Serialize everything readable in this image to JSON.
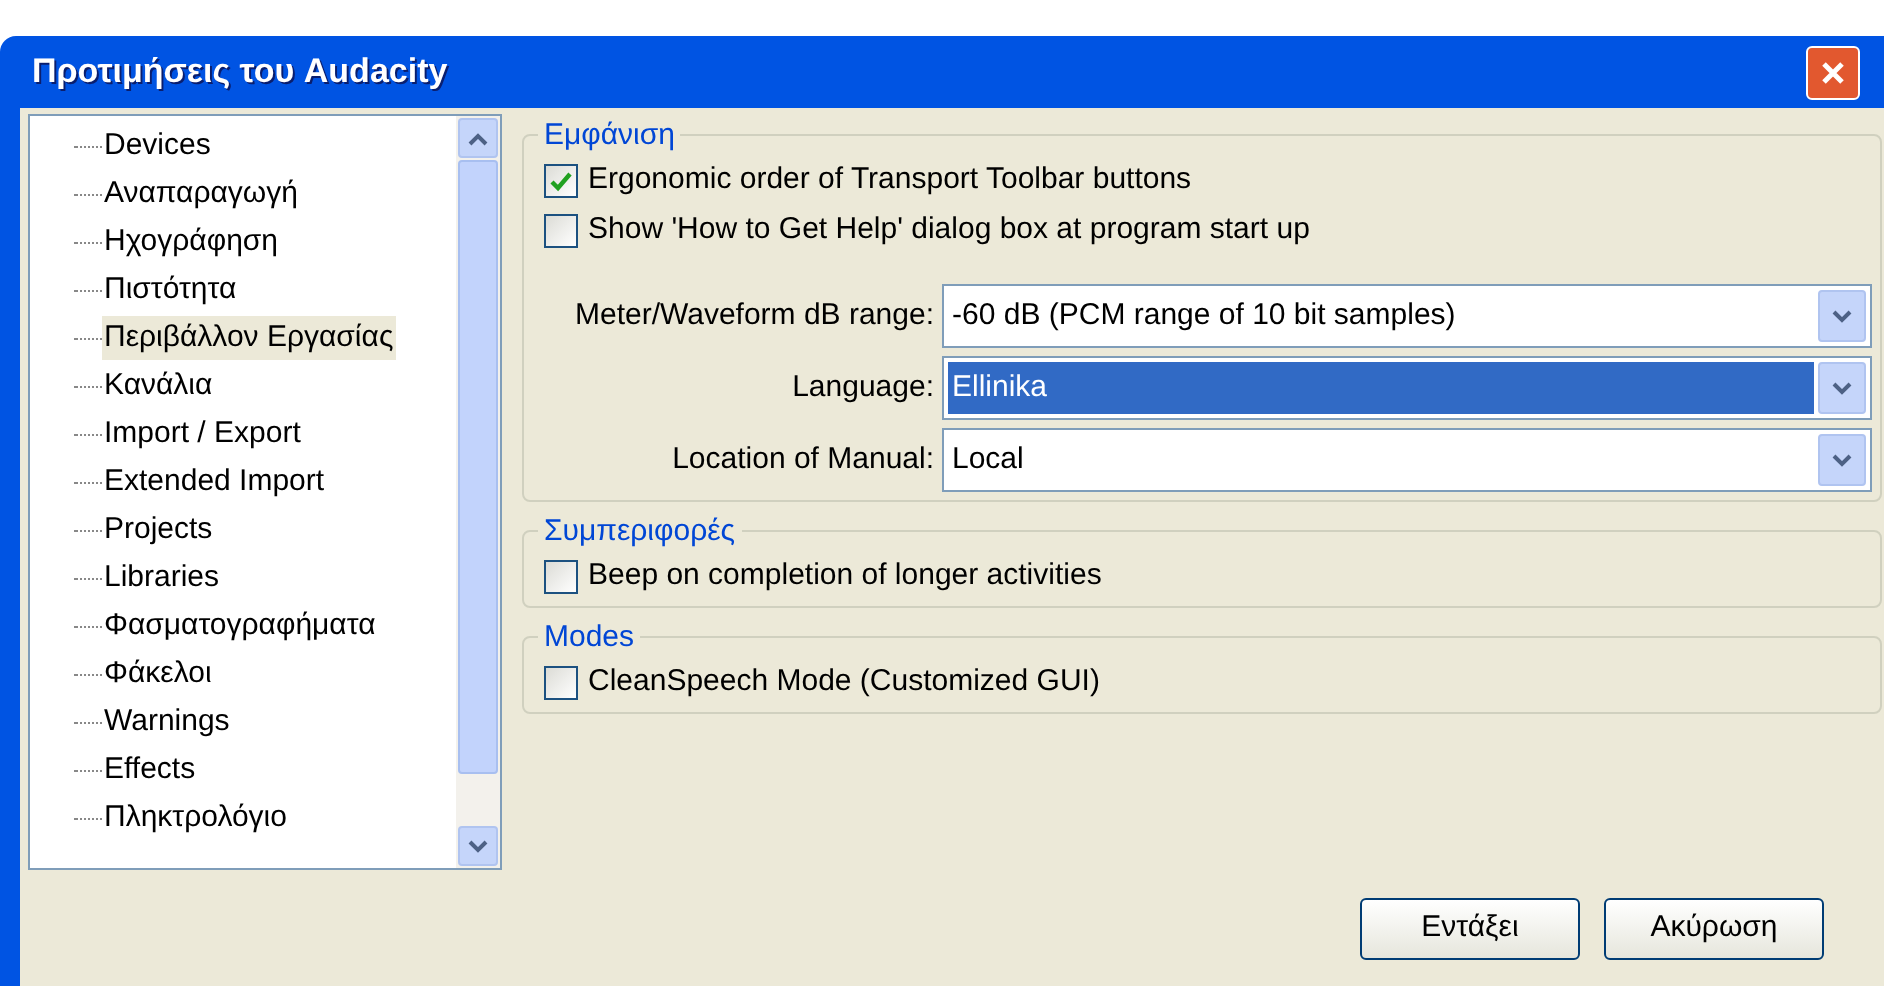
{
  "window": {
    "title": "Προτιμήσεις του Audacity"
  },
  "sidebar": {
    "items": [
      {
        "label": "Devices",
        "selected": false
      },
      {
        "label": "Αναπαραγωγή",
        "selected": false
      },
      {
        "label": "Ηχογράφηση",
        "selected": false
      },
      {
        "label": "Πιστότητα",
        "selected": false
      },
      {
        "label": "Περιβάλλον Εργασίας",
        "selected": true
      },
      {
        "label": "Κανάλια",
        "selected": false
      },
      {
        "label": "Import / Export",
        "selected": false
      },
      {
        "label": "Extended Import",
        "selected": false
      },
      {
        "label": "Projects",
        "selected": false
      },
      {
        "label": "Libraries",
        "selected": false
      },
      {
        "label": "Φασματογραφήματα",
        "selected": false
      },
      {
        "label": "Φάκελοι",
        "selected": false
      },
      {
        "label": "Warnings",
        "selected": false
      },
      {
        "label": "Effects",
        "selected": false
      },
      {
        "label": "Πληκτρολόγιο",
        "selected": false
      }
    ]
  },
  "groups": [
    {
      "title": "Εμφάνιση",
      "items": [
        {
          "kind": "checkbox",
          "label": "Ergonomic order of Transport Toolbar buttons",
          "checked": true
        },
        {
          "kind": "checkbox",
          "label": "Show 'How to Get Help' dialog box at program start up",
          "checked": false
        },
        {
          "kind": "select",
          "label": "Meter/Waveform dB range:",
          "value": "-60 dB (PCM range of 10 bit samples)",
          "focused": false
        },
        {
          "kind": "select",
          "label": "Language:",
          "value": "Ellinika",
          "focused": true
        },
        {
          "kind": "select",
          "label": "Location of Manual:",
          "value": "Local",
          "focused": false
        }
      ]
    },
    {
      "title": "Συμπεριφορές",
      "items": [
        {
          "kind": "checkbox",
          "label": "Beep on completion of longer activities",
          "checked": false
        }
      ]
    },
    {
      "title": "Modes",
      "items": [
        {
          "kind": "checkbox",
          "label": "CleanSpeech Mode (Customized GUI)",
          "checked": false
        }
      ]
    }
  ],
  "buttons": [
    "Εντάξει",
    "Ακύρωση"
  ]
}
